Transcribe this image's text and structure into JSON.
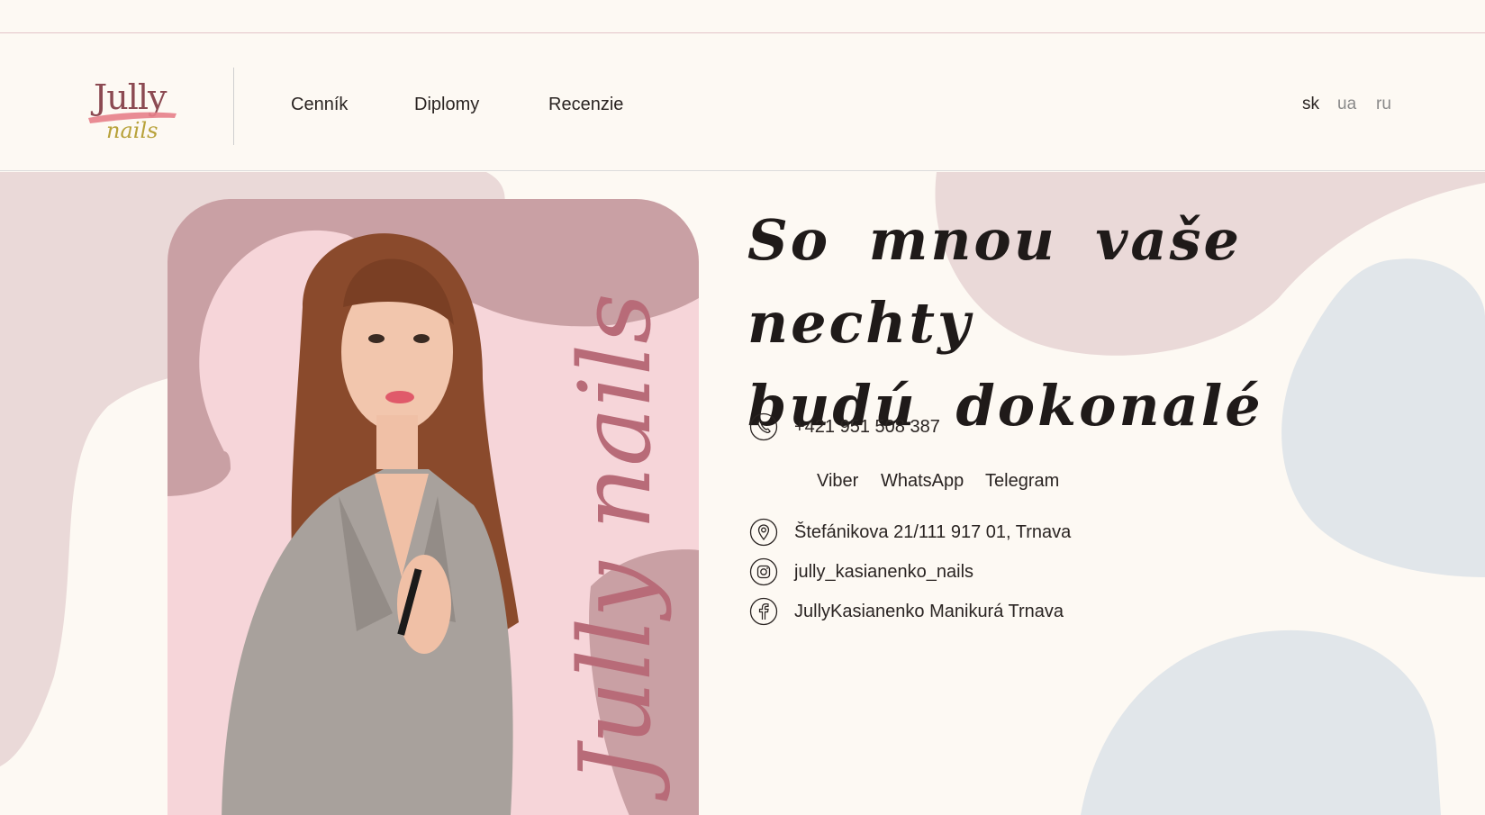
{
  "brand": {
    "logo_word": "Jully",
    "logo_sub": "nails",
    "accent_pink": "#e7808a",
    "accent_gold": "#b8a23a",
    "logo_color": "#8c4a52"
  },
  "nav": {
    "items": [
      {
        "label": "Cenník"
      },
      {
        "label": "Diplomy"
      },
      {
        "label": "Recenzie"
      }
    ]
  },
  "languages": {
    "items": [
      {
        "label": "sk",
        "active": true
      },
      {
        "label": "ua",
        "active": false
      },
      {
        "label": "ru",
        "active": false
      }
    ]
  },
  "hero": {
    "headline_line1": "So mnou vaše nechty",
    "headline_line2": "budú dokonalé",
    "photo_caption": "Jully nails"
  },
  "contacts": {
    "phone": "+421 951 508 387",
    "messengers": [
      {
        "label": "Viber"
      },
      {
        "label": "WhatsApp"
      },
      {
        "label": "Telegram"
      }
    ],
    "address": "Štefánikova 21/111 917 01, Trnava",
    "instagram": "jully_kasianenko_nails",
    "facebook": "JullyKasianenko Manikurá Trnava"
  },
  "colors": {
    "background": "#fdf9f3",
    "blob_pink": "#ead9d8",
    "blob_blue": "#e1e6ea",
    "card_pink": "#f6d5d9",
    "card_mauve": "#c9a0a4"
  }
}
